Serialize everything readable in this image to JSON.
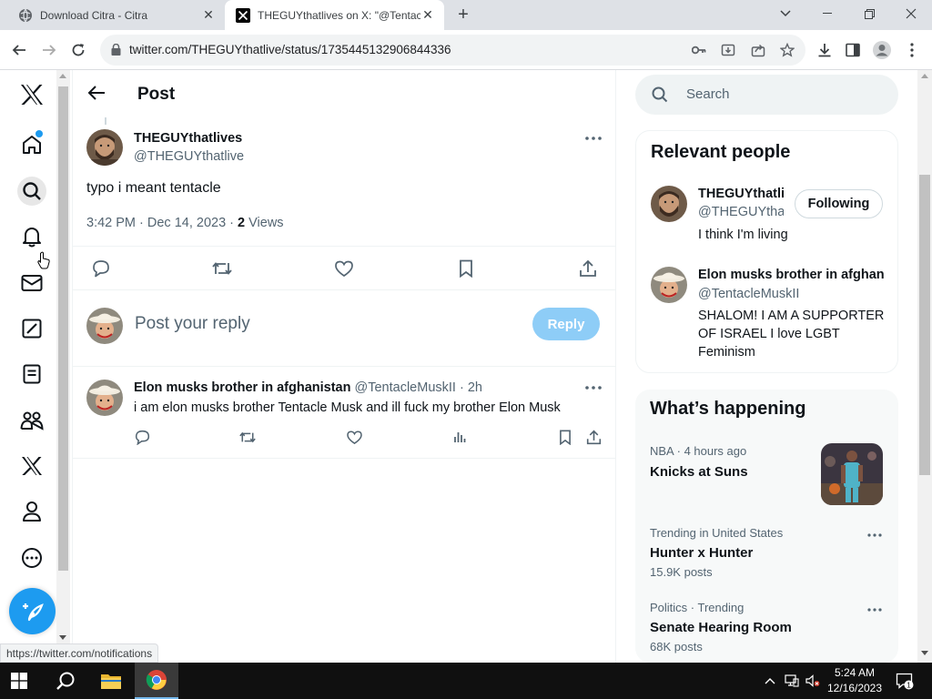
{
  "browser": {
    "tabs": [
      {
        "title": "Download Citra - Citra",
        "favicon": "citra-globe-icon"
      },
      {
        "title": "THEGUYthatlives on X: \"@Tentacl",
        "favicon": "x-logo-icon"
      }
    ],
    "url": "twitter.com/THEGUYthatlive/status/1735445132906844336",
    "status_url": "https://twitter.com/notifications"
  },
  "nav": {
    "items": [
      "x-logo-icon",
      "home-icon",
      "search-icon",
      "notifications-icon",
      "messages-icon",
      "grok-icon",
      "lists-icon",
      "communities-icon",
      "premium-icon",
      "profile-icon",
      "more-icon"
    ],
    "compose_label": "Post"
  },
  "header": {
    "title": "Post"
  },
  "post": {
    "author_name": "THEGUYthatlives",
    "author_handle": "@THEGUYthatlive",
    "text": "typo i meant tentacle",
    "time": "3:42 PM · Dec 14, 2023 · ",
    "views_count": "2",
    "views_label": " Views"
  },
  "reply_box": {
    "placeholder": "Post your reply",
    "button": "Reply"
  },
  "reply": {
    "author_name": "Elon musks brother in afghanistan",
    "author_handle": "@TentacleMuskII",
    "time": " · 2h",
    "text": "i am elon musks brother Tentacle Musk and ill fuck my brother Elon Musk"
  },
  "sidebar": {
    "search_placeholder": "Search",
    "relevant_title": "Relevant people",
    "people": [
      {
        "name": "THEGUYthatlives",
        "handle": "@THEGUYthatlive",
        "bio": "I think I'm living",
        "button": "Following"
      },
      {
        "name": "Elon musks brother in afghanistan",
        "handle": "@TentacleMuskII",
        "bio": "SHALOM! I AM A SUPPORTER OF ISRAEL I love LGBT Feminism"
      }
    ],
    "happening_title": "What’s happening",
    "trends": [
      {
        "meta": "NBA · 4 hours ago",
        "title": "Knicks at Suns",
        "count": ""
      },
      {
        "meta": "Trending in United States",
        "title": "Hunter x Hunter",
        "count": "15.9K posts"
      },
      {
        "meta": "Politics · Trending",
        "title": "Senate Hearing Room",
        "count": "68K posts"
      }
    ]
  },
  "taskbar": {
    "time": "5:24 AM",
    "date": "12/16/2023",
    "notification_count": "1"
  }
}
